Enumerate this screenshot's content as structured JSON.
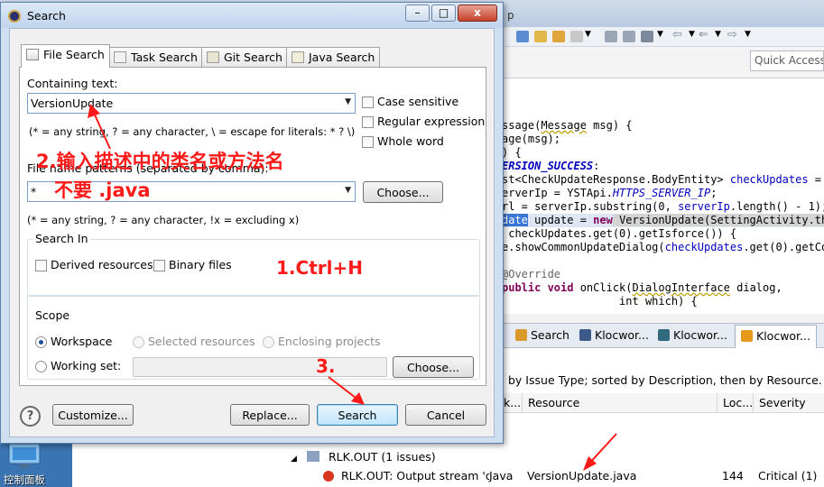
{
  "ide": {
    "quick_access_placeholder": "Quick Access",
    "title_fragment": "p",
    "code_lines": [
      [
        "ssage(",
        "Message",
        " msg) {"
      ],
      [
        "age(msg);"
      ],
      [
        ") {"
      ],
      [
        "ERSION_SUCCESS",
        ":"
      ],
      [
        "st<CheckUpdateResponse.BodyEntity> ",
        "checkUpdates",
        " = ("
      ],
      [
        "erverIp = YSTApi.",
        "HTTPS_SERVER_IP",
        ";"
      ],
      [
        "rl = serverIp.substring(0, ",
        "serverIp",
        ".length() - 1);"
      ],
      [
        "date",
        " update = ",
        "new",
        " VersionUpdate(SettingActivity.th"
      ],
      [
        " checkUpdates.get(0).getIsforce()) {"
      ],
      [
        "e.showCommonUpdateDialog(",
        "checkUpdates",
        ".get(0).getCo"
      ],
      [
        ""
      ],
      [
        "@Override"
      ],
      [
        "public void",
        " onClick(",
        "DialogInterface",
        " dialog,"
      ],
      [
        "                  int which) {"
      ]
    ],
    "view_tabs": [
      {
        "label": "Search"
      },
      {
        "label": "Klocwor..."
      },
      {
        "label": "Klocwor..."
      },
      {
        "label": "Klocwor..."
      }
    ],
    "issues_description": "by Issue Type; sorted by Description, then by Resource.",
    "columns": [
      "k...",
      "Resource",
      "Loc...",
      "Severity"
    ],
    "group_row": "RLK.OUT (1 issues)",
    "issue_row": {
      "description": "RLK.OUT: Output stream 'o",
      "type": "Java",
      "resource": "VersionUpdate.java",
      "location": "144",
      "severity": "Critical (1)"
    },
    "desktop_label": "控制面板"
  },
  "dialog": {
    "title": "Search",
    "window_buttons": {
      "minimize": "–",
      "maximize": "□",
      "close": "x"
    },
    "tabs": [
      {
        "label": "File Search",
        "active": true
      },
      {
        "label": "Task Search",
        "active": false
      },
      {
        "label": "Git Search",
        "active": false
      },
      {
        "label": "Java Search",
        "active": false
      }
    ],
    "containing_text_label": "Containing text:",
    "containing_text_value": "VersionUpdate",
    "containing_hint": "(* = any string, ? = any character, \\ = escape for literals: * ? \\)",
    "case_sensitive": "Case sensitive",
    "regular_expression": "Regular expression",
    "whole_word": "Whole word",
    "file_patterns_label": "File name patterns (separated by comma):",
    "file_patterns_value": "*",
    "choose_label": "Choose...",
    "file_patterns_hint": "(* = any string, ? = any character, !x = excluding x)",
    "search_in_title": "Search In",
    "derived_resources": "Derived resources",
    "binary_files": "Binary files",
    "scope_title": "Scope",
    "workspace": "Workspace",
    "selected_resources": "Selected resources",
    "enclosing_projects": "Enclosing projects",
    "working_set": "Working set:",
    "working_set_choose": "Choose...",
    "help": "?",
    "customize": "Customize...",
    "replace": "Replace...",
    "search": "Search",
    "cancel": "Cancel"
  },
  "annotations": {
    "step2_line1": "2.输入描述中的类名或方法名",
    "step2_line2": "不要 .java",
    "step1": "1.Ctrl+H",
    "step3": "3."
  },
  "colors": {
    "annotation": "#ff1a1a",
    "selection": "#3875d7",
    "keyword": "#7f0055",
    "field": "#0000c0"
  }
}
